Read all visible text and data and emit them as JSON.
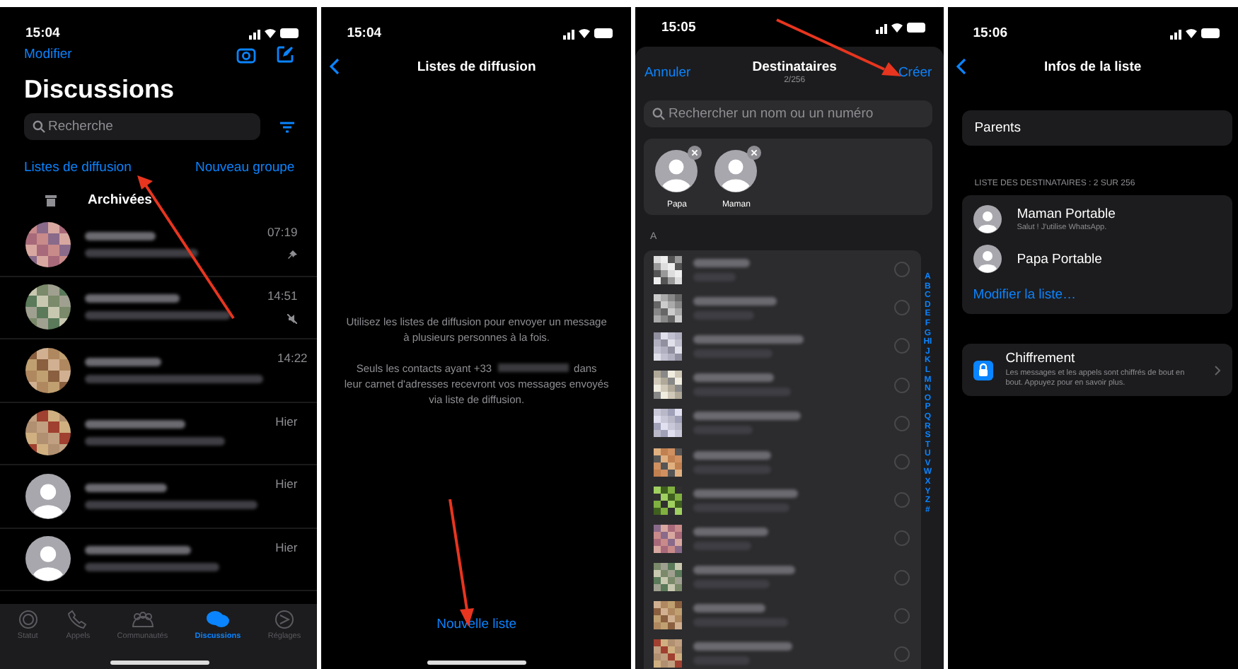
{
  "chats_screen": {
    "status_time": "15:04",
    "edit": "Modifier",
    "title": "Discussions",
    "search": {
      "placeholder": "Recherche"
    },
    "broadcast_link": "Listes de diffusion",
    "new_group": "Nouveau groupe",
    "archived": "Archivées",
    "chats": [
      {
        "time": "07:19",
        "pinned": true,
        "muted": false
      },
      {
        "time": "14:51",
        "pinned": false,
        "muted": true
      },
      {
        "time": "14:22",
        "pinned": false,
        "muted": false
      },
      {
        "time": "Hier",
        "pinned": false,
        "muted": false
      },
      {
        "kind": "default",
        "time": "Hier",
        "pinned": false,
        "muted": false
      },
      {
        "kind": "default",
        "time": "Hier",
        "pinned": false,
        "muted": false
      }
    ],
    "tab_bar": [
      {
        "label": "Statut",
        "selected": false
      },
      {
        "label": "Appels",
        "selected": false
      },
      {
        "label": "Communautés",
        "selected": false
      },
      {
        "label": "Discussions",
        "selected": true
      },
      {
        "label": "Réglages",
        "selected": false
      }
    ]
  },
  "broadcast_screen": {
    "status_time": "15:04",
    "title": "Listes de diffusion",
    "intro": "Utilisez les listes de diffusion pour envoyer un message à plusieurs personnes à la fois.",
    "notice_start": "Seuls les contacts ayant +33",
    "notice_middle": "dans",
    "notice_end": "leur carnet d'adresses recevront vos messages envoyés via liste de diffusion.",
    "new_list": "Nouvelle liste"
  },
  "recipients_screen": {
    "status_time": "15:05",
    "cancel": "Annuler",
    "title": "Destinataires",
    "count": "2/256",
    "create": "Créer",
    "search": {
      "placeholder": "Rechercher un nom ou un numéro"
    },
    "chosen": [
      {
        "name": "Papa"
      },
      {
        "name": "Maman"
      }
    ],
    "section": "A",
    "contacts": [
      {
        "selected": false
      },
      {
        "selected": false
      },
      {
        "selected": false
      },
      {
        "selected": false
      },
      {
        "selected": false
      },
      {
        "selected": false
      },
      {
        "selected": false
      },
      {
        "selected": false
      },
      {
        "selected": false
      },
      {
        "selected": false
      },
      {
        "selected": false
      }
    ],
    "index": "ABCDEFGHIJKLMNOPQRSTUVWXYZ#"
  },
  "list_info_screen": {
    "status_time": "15:06",
    "title": "Infos de la liste",
    "list_name": "Parents",
    "recipients_header": "LISTE DES DESTINATAIRES : 2 SUR 256",
    "recipients": [
      {
        "name": "Maman Portable",
        "status": "Salut ! J'utilise WhatsApp."
      },
      {
        "name": "Papa Portable"
      }
    ],
    "edit_list": "Modifier la liste…",
    "encryption": {
      "title": "Chiffrement",
      "description": "Les messages et les appels sont chiffrés de bout en bout. Appuyez pour en savoir plus."
    }
  }
}
